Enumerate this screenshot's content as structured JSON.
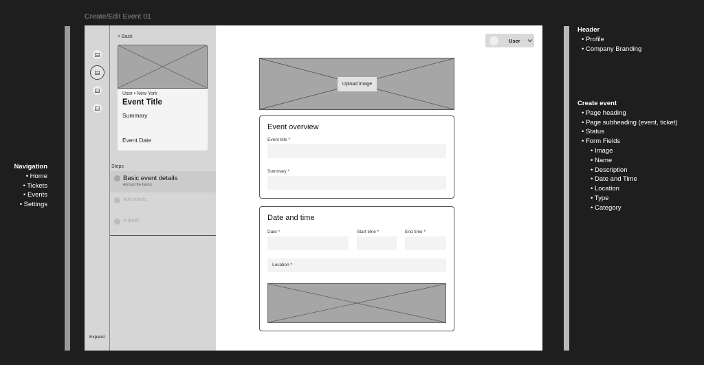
{
  "frame_title": "Create/Edit Event 01",
  "notes": {
    "navigation": {
      "heading": "Navigation",
      "items": [
        "Home",
        "Tickets",
        "Events",
        "Settings"
      ]
    },
    "header": {
      "heading": "Header",
      "items": [
        "Profile",
        "Company Branding"
      ]
    },
    "create_event": {
      "heading": "Create event",
      "items": [
        "Page heading",
        "Page subheading (event, ticket)",
        "Status",
        "Form Fields"
      ],
      "form_fields": [
        "Image",
        "Name",
        "Description",
        "Date and Time",
        "Location",
        "Type",
        "Category"
      ]
    }
  },
  "rail": {
    "icons": [
      "image-icon",
      "image-icon",
      "image-icon",
      "image-icon"
    ],
    "expand_label": "Expand"
  },
  "panel": {
    "back_label": "< Back",
    "card": {
      "meta": "User • New York",
      "title": "Event Title",
      "summary": "Summary",
      "date": "Event Date"
    },
    "steps_label": "Steps",
    "steps": [
      {
        "label": "Basic event details",
        "sub": "Add just the basics",
        "active": true
      },
      {
        "label": "Add tickets",
        "active": false
      },
      {
        "label": "Publish",
        "active": false
      }
    ]
  },
  "header": {
    "user_label": "User"
  },
  "hero": {
    "upload_label": "Upload image"
  },
  "overview": {
    "title": "Event overview",
    "event_title_label": "Event title *",
    "summary_label": "Summary *"
  },
  "date_time": {
    "title": "Date and time",
    "date_label": "Date *",
    "start_label": "Start time *",
    "end_label": "End time *",
    "location_label": "Location *"
  }
}
